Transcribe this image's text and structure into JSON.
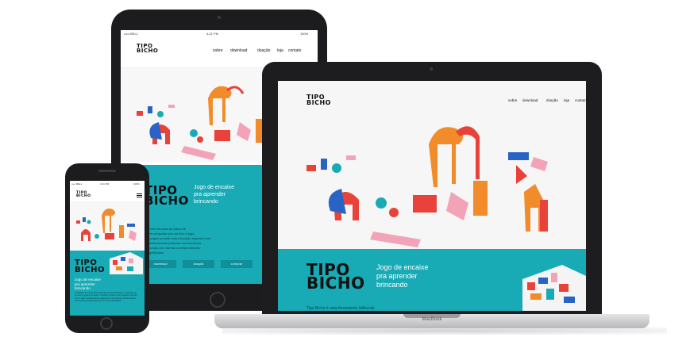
{
  "site": {
    "logo_line1": "TIPO",
    "logo_line2": "BICHO",
    "nav": [
      "sobre",
      "download",
      "doação",
      "loja",
      "contato"
    ],
    "tagline_lines": [
      "Jogo de encaixe",
      "pra aprender",
      "brincando"
    ],
    "description": "Tipo Bicho é uma ferramenta lúdica de aprendizagem composta por um livro e jogo de encaixe. O projeto propõe uma interação especial com o leitor, transformando palavras em esculturas tridimensionais com formas correspondentes aos seus significados.",
    "description_tablet_lines": [
      "o é uma ferramenta lúdica de",
      "agem composta por um livro e jogo",
      ". O projeto propõe uma interação especial com",
      "r, transformando palavras em esculturas",
      "ensionais com formas correspondentes",
      "s significados."
    ],
    "buttons": [
      "download",
      "doação",
      "comprar"
    ],
    "laptop_cutoff_text": "Tipo Bicho é uma ferramenta lúdica de"
  },
  "tablet_status": {
    "carrier": "••••• BELL",
    "time": "4:21 PM",
    "battery": "100%"
  },
  "phone_status": {
    "carrier": "••••• BELL",
    "time": "4:21 PM",
    "battery": "100%"
  },
  "laptop_brand": "MacBook",
  "colors": {
    "teal": "#18aab5",
    "teal_dark": "#0f8f99",
    "red": "#e8423a",
    "orange": "#f28b2a",
    "blue": "#2a63c6",
    "pink": "#f2a3b8"
  }
}
